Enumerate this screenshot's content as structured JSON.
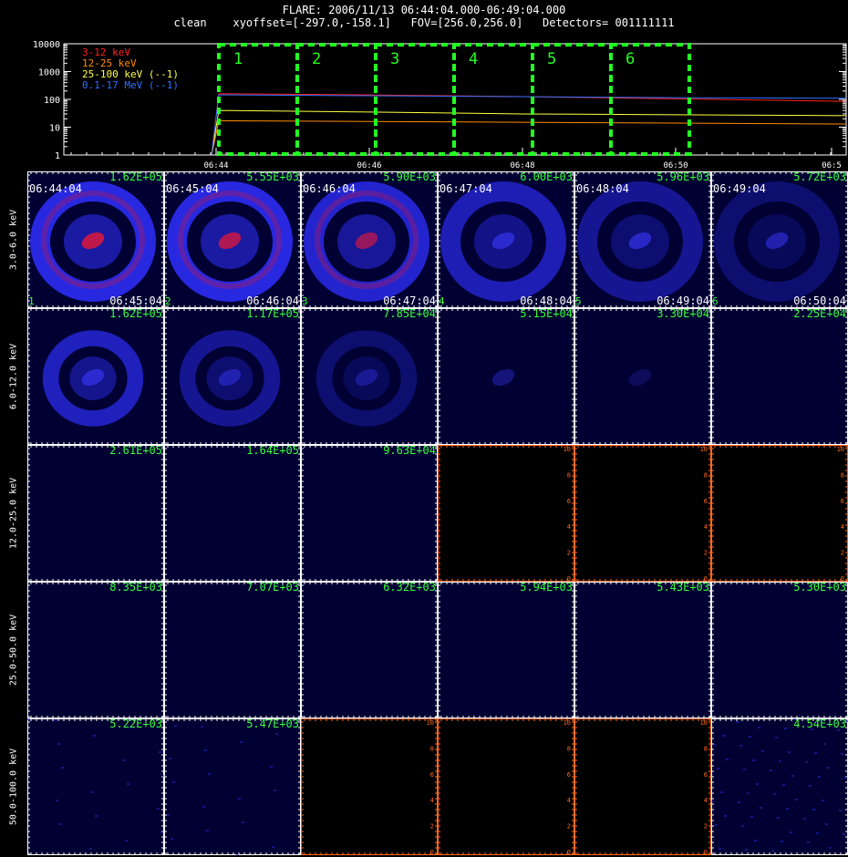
{
  "header": {
    "title_line": "FLARE: 2006/11/13 06:44:04.000-06:49:04.000",
    "info_line": "clean    xyoffset=[-297.0,-158.1]   FOV=[256.0,256.0]   Detectors= 001111111"
  },
  "lightcurve": {
    "y_ticks": [
      "10000",
      "1000",
      "100",
      "10",
      "1"
    ],
    "x_ticks": [
      "06:44",
      "06:46",
      "06:48",
      "06:50",
      "06:5"
    ],
    "legend": [
      {
        "label": "3-12 keV",
        "color": "#ff2020"
      },
      {
        "label": "12-25 keV",
        "color": "#ff8c00"
      },
      {
        "label": "25-100 keV (--1)",
        "color": "#ffff40"
      },
      {
        "label": "0.1-17 MeV (--1)",
        "color": "#3070ff"
      }
    ],
    "boxes": [
      "1",
      "2",
      "3",
      "4",
      "5",
      "6"
    ],
    "box_color": "#22ff22",
    "chart_data": {
      "type": "line",
      "ylog": true,
      "ylim": [
        1,
        10000
      ],
      "xlim": [
        "06:42",
        "06:52"
      ],
      "series": [
        {
          "name": "3-12 keV",
          "x": [
            "06:44:00",
            "06:44:04",
            "06:46",
            "06:48",
            "06:50",
            "06:52"
          ],
          "values": [
            1,
            160,
            145,
            125,
            105,
            85
          ]
        },
        {
          "name": "12-25 keV",
          "x": [
            "06:44:00",
            "06:44:04",
            "06:46",
            "06:48",
            "06:50",
            "06:52"
          ],
          "values": [
            1,
            17,
            16,
            15,
            14,
            13
          ]
        },
        {
          "name": "25-100 keV (--1)",
          "x": [
            "06:44:00",
            "06:44:04",
            "06:46",
            "06:48",
            "06:50",
            "06:52"
          ],
          "values": [
            1,
            40,
            35,
            30,
            28,
            26
          ]
        },
        {
          "name": "0.1-17 MeV (--1)",
          "x": [
            "06:44:00",
            "06:44:04",
            "06:46",
            "06:48",
            "06:50",
            "06:52"
          ],
          "values": [
            1,
            145,
            135,
            125,
            115,
            110
          ]
        }
      ]
    }
  },
  "energy_bands": [
    "3.0-6.0 keV",
    "6.0-12.0 keV",
    "12.0-25.0 keV",
    "25.0-50.0 keV",
    "50.0-100.0 keV"
  ],
  "time_starts": [
    "06:44:04",
    "06:45:04",
    "06:46:04",
    "06:47:04",
    "06:48:04",
    "06:49:04"
  ],
  "time_ends": [
    "06:45:04",
    "06:46:04",
    "06:47:04",
    "06:48:04",
    "06:49:04",
    "06:50:04"
  ],
  "interval_numbers": [
    "1",
    "2",
    "3",
    "4",
    "5",
    "6"
  ],
  "panel_max": [
    [
      "1.62E+05",
      "5.55E+03",
      "5.90E+03",
      "6.00E+03",
      "5.96E+03",
      "5.72E+03"
    ],
    [
      "1.62E+05",
      "1.17E+05",
      "7.85E+04",
      "5.15E+04",
      "3.30E+04",
      "2.25E+04"
    ],
    [
      "2.61E+05",
      "1.64E+05",
      "9.63E+04",
      "",
      "",
      ""
    ],
    [
      "8.35E+03",
      "7.07E+03",
      "6.32E+03",
      "5.94E+03",
      "5.43E+03",
      "5.30E+03"
    ],
    [
      "5.22E+03",
      "5.47E+03",
      "",
      "",
      "",
      "4.54E+03"
    ]
  ],
  "empty_axis_ticks": [
    "10",
    "8",
    "6",
    "4",
    "2",
    "0"
  ],
  "colors": {
    "panel_bg": "#000033",
    "ring": "#2f2fff",
    "core": "#c0184a",
    "empty_axis": "#ff6a20",
    "label_green": "#39ff39"
  }
}
